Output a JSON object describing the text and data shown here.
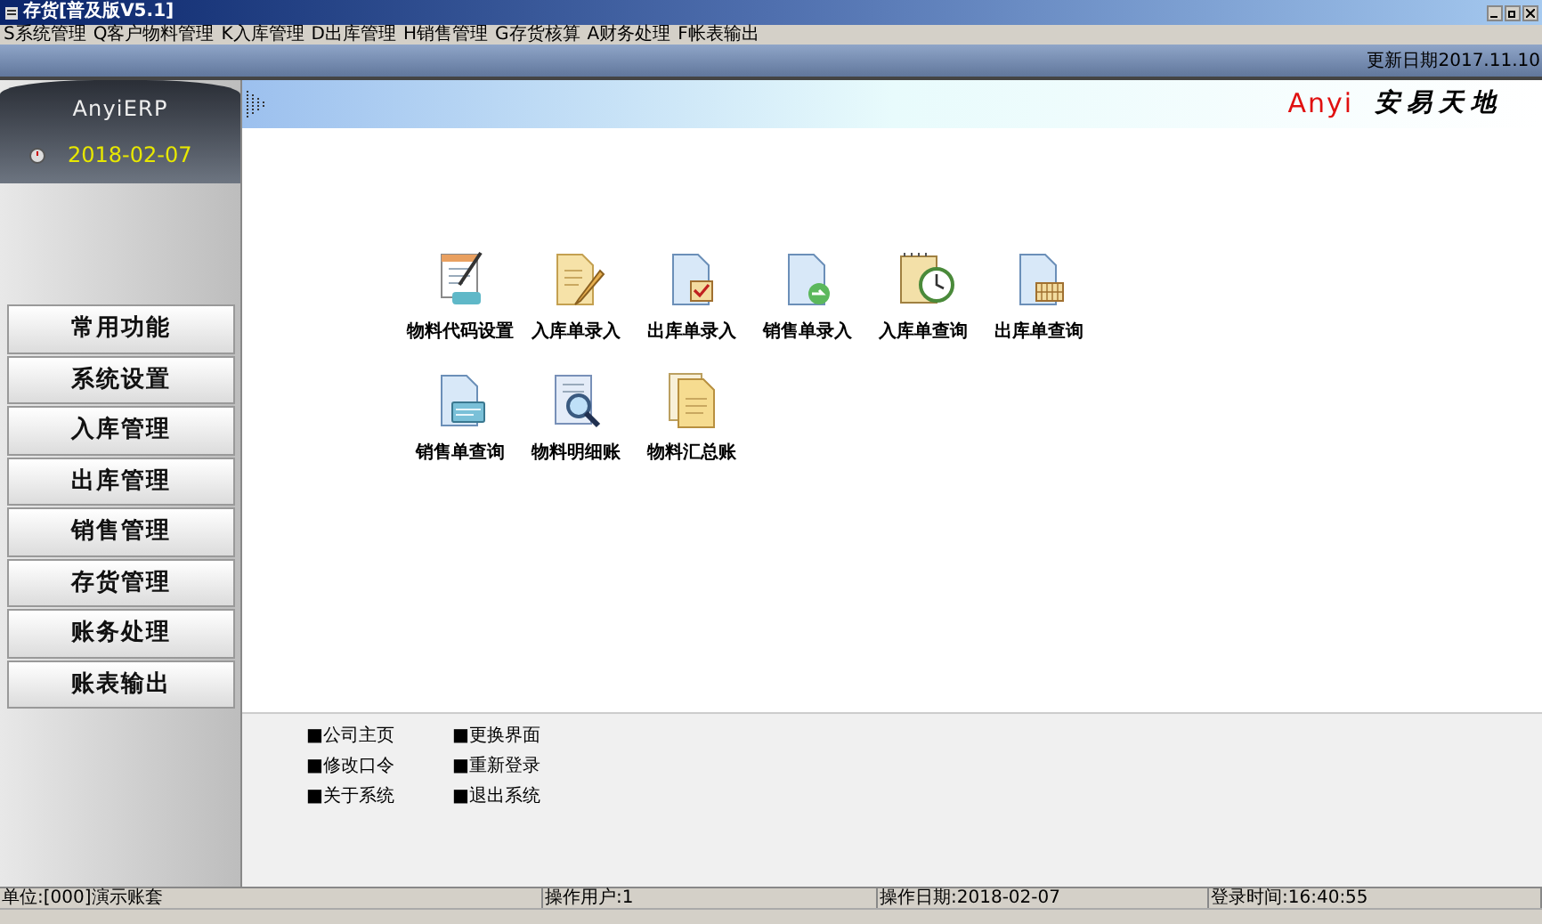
{
  "window": {
    "title": "存货[普及版V5.1]"
  },
  "menu": [
    "S系统管理",
    "Q客户物料管理",
    "K入库管理",
    "D出库管理",
    "H销售管理",
    "G存货核算",
    "A财务处理",
    "F帐表输出"
  ],
  "update_date": "更新日期2017.11.10",
  "sidebar": {
    "product": "AnyiERP",
    "date": "2018-02-07",
    "items": [
      "常用功能",
      "系统设置",
      "入库管理",
      "出库管理",
      "销售管理",
      "存货管理",
      "账务处理",
      "账表输出"
    ]
  },
  "brand": {
    "latin": "Anyi",
    "chinese": "安易天地"
  },
  "shortcuts": [
    {
      "label": "物料代码设置",
      "kind": "edit"
    },
    {
      "label": "入库单录入",
      "kind": "pencil"
    },
    {
      "label": "出库单录入",
      "kind": "check"
    },
    {
      "label": "销售单录入",
      "kind": "recycle"
    },
    {
      "label": "入库单查询",
      "kind": "clock"
    },
    {
      "label": "出库单查询",
      "kind": "grid"
    },
    {
      "label": "销售单查询",
      "kind": "card"
    },
    {
      "label": "物料明细账",
      "kind": "search"
    },
    {
      "label": "物料汇总账",
      "kind": "ledger"
    }
  ],
  "links": [
    "■公司主页",
    "■更换界面",
    "■修改口令",
    "■重新登录",
    "■关于系统",
    "■退出系统"
  ],
  "status": [
    "单位:[000]演示账套",
    "操作用户:1",
    "操作日期:2018-02-07",
    "登录时间:16:40:55"
  ]
}
